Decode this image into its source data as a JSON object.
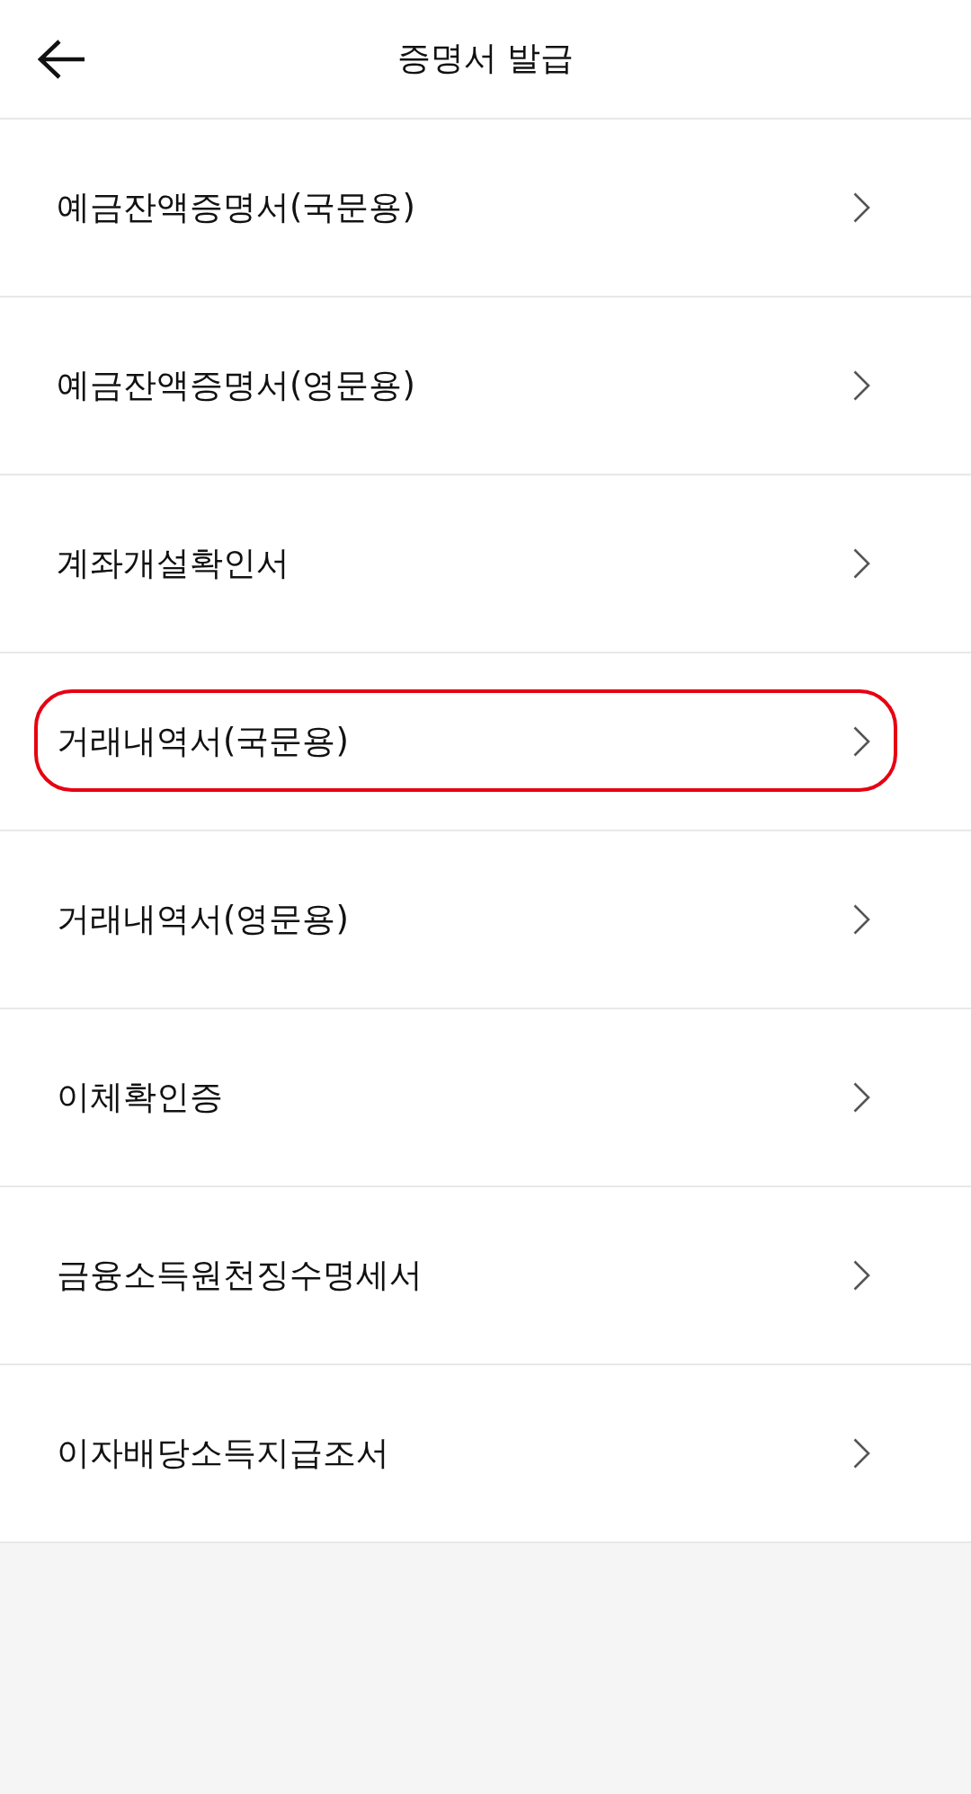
{
  "header": {
    "title": "증명서 발급"
  },
  "items": [
    {
      "label": "예금잔액증명서(국문용)",
      "highlighted": false
    },
    {
      "label": "예금잔액증명서(영문용)",
      "highlighted": false
    },
    {
      "label": "계좌개설확인서",
      "highlighted": false
    },
    {
      "label": "거래내역서(국문용)",
      "highlighted": true
    },
    {
      "label": "거래내역서(영문용)",
      "highlighted": false
    },
    {
      "label": "이체확인증",
      "highlighted": false
    },
    {
      "label": "금융소득원천징수명세서",
      "highlighted": false
    },
    {
      "label": "이자배당소득지급조서",
      "highlighted": false
    }
  ]
}
